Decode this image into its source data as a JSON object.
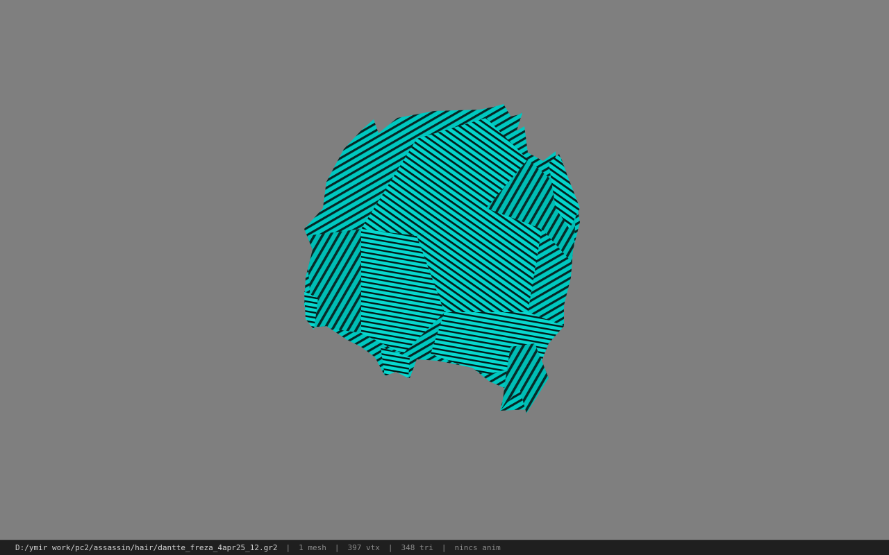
{
  "viewer": {
    "background_color": "#7f7f7f",
    "model_color": "#00c8c0",
    "stripe_color": "#062624",
    "model_icon": "hair-mesh-render"
  },
  "status": {
    "file_path": "D:/ymir work/pc2/assassin/hair/dantte_freza_4apr25_12.gr2",
    "separator": "|",
    "mesh_count": "1 mesh",
    "vertex_count": "397 vtx",
    "triangle_count": "348 tri",
    "anim_status": "nincs anim"
  }
}
